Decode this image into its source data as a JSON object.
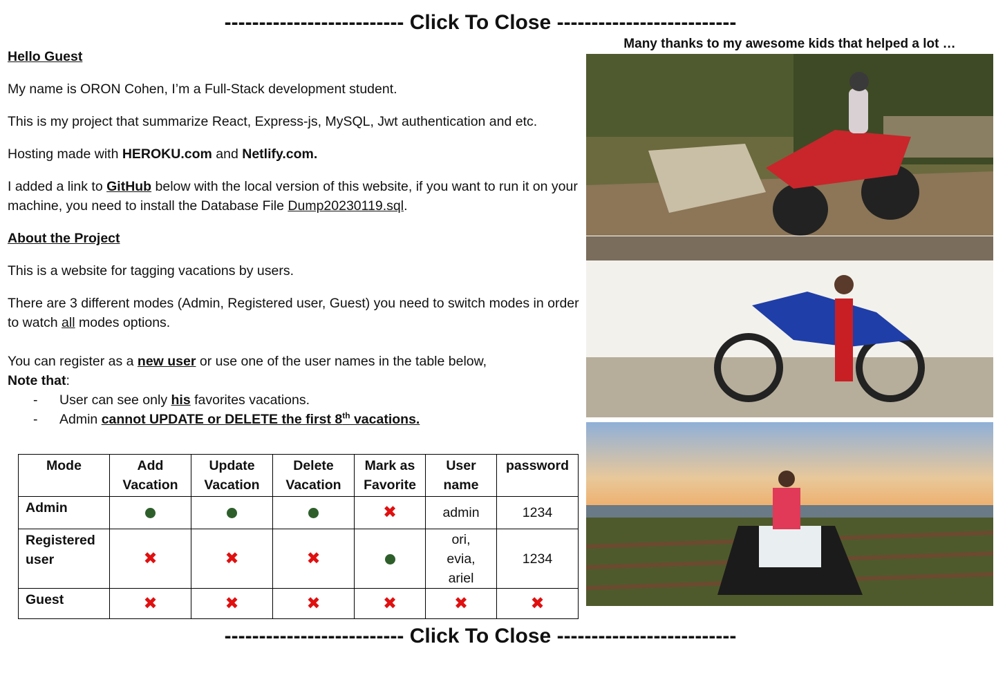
{
  "close_label": "-------------------------- Click To Close --------------------------",
  "intro": {
    "greeting": "Hello Guest",
    "line1": "My name is ORON Cohen, I’m a Full-Stack development student.",
    "line2": "This is my project that summarize React, Express-js, MySQL, Jwt authentication and etc.",
    "hosting_prefix": "Hosting made with ",
    "hosting_1": "HEROKU.com",
    "hosting_mid": " and ",
    "hosting_2": "Netlify.com.",
    "github_prefix": "I added a link to ",
    "github_link": "GitHub",
    "github_suffix": " below with the local version of this website, if you want to run it on your machine, you need to install the Database File ",
    "db_file": "Dump20230119.sql",
    "db_suffix": "."
  },
  "about": {
    "heading": "About the Project",
    "line1": "This is a website for tagging vacations by users.",
    "modes_prefix": "There are 3 different modes (Admin, Registered user, Guest) you need to switch modes in order to watch ",
    "modes_all": "all",
    "modes_suffix": " modes options.",
    "register_prefix": "You can register as a ",
    "register_link": "new user",
    "register_suffix": " or use one of the user names in the table below,",
    "note_label": "Note that",
    "note_colon": ":",
    "bullet1_prefix": "User can see only ",
    "bullet1_emph": "his",
    "bullet1_suffix": " favorites vacations.",
    "bullet2_prefix": "Admin ",
    "bullet2_emph": "cannot UPDATE or DELETE the first 8",
    "bullet2_sup": "th",
    "bullet2_suffix": " vacations."
  },
  "table": {
    "headers": {
      "mode": "Mode",
      "add_1": "Add",
      "add_2": "Vacation",
      "update_1": "Update",
      "update_2": "Vacation",
      "delete_1": "Delete",
      "delete_2": "Vacation",
      "fav_1": "Mark as",
      "fav_2": "Favorite",
      "user_1": "User",
      "user_2": "name",
      "password": "password"
    },
    "admin": {
      "mode": "Admin",
      "user": "admin",
      "password": "1234"
    },
    "registered": {
      "mode_1": "Registered",
      "mode_2": "user",
      "user_1": "ori,",
      "user_2": "evia,",
      "user_3": "ariel",
      "password": "1234"
    },
    "guest": {
      "mode": "Guest"
    },
    "allowed_symbol": "●",
    "denied_symbol": "✖"
  },
  "thanks": "Many thanks to my awesome kids that helped a lot …",
  "colors": {
    "allowed": "#2e5f2b",
    "denied": "#e01010"
  }
}
